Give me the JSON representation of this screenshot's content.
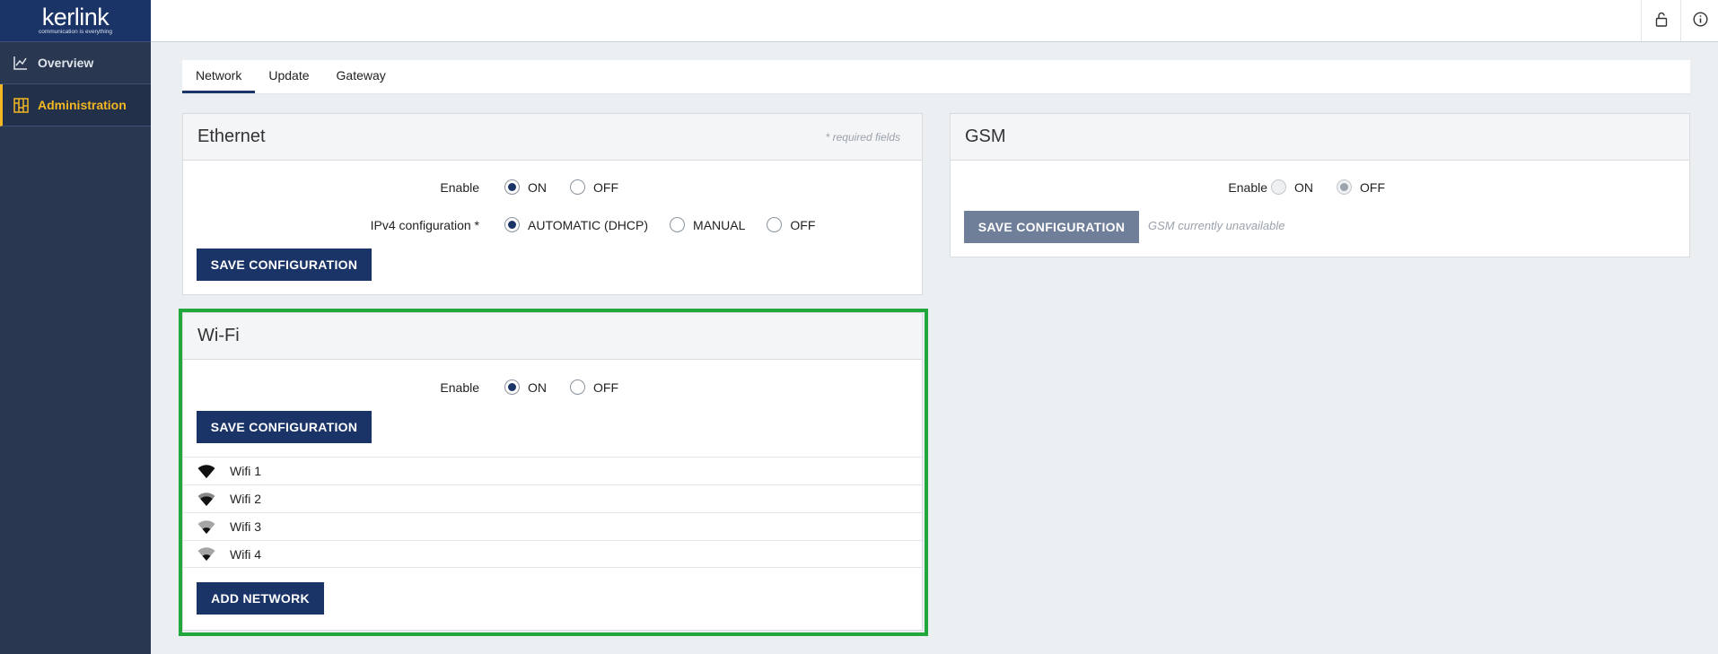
{
  "logo": {
    "word": "kerlink",
    "tagline": "communication is everything"
  },
  "sidebar": {
    "items": [
      {
        "label": "Overview",
        "icon": "chart-line-icon"
      },
      {
        "label": "Administration",
        "icon": "building-icon"
      }
    ]
  },
  "topbar": {
    "icons": [
      "unlock-icon",
      "info-icon"
    ]
  },
  "tabs": [
    {
      "label": "Network"
    },
    {
      "label": "Update"
    },
    {
      "label": "Gateway"
    }
  ],
  "ethernet": {
    "title": "Ethernet",
    "required_note": "* required fields",
    "enable_label": "Enable",
    "enable_on": "ON",
    "enable_off": "OFF",
    "ipv4_label": "IPv4 configuration *",
    "ipv4_automatic": "AUTOMATIC (DHCP)",
    "ipv4_manual": "MANUAL",
    "ipv4_off": "OFF",
    "save_label": "SAVE CONFIGURATION"
  },
  "gsm": {
    "title": "GSM",
    "enable_label": "Enable",
    "enable_on": "ON",
    "enable_off": "OFF",
    "save_label": "SAVE CONFIGURATION",
    "unavailable_note": "GSM currently unavailable"
  },
  "wifi": {
    "title": "Wi-Fi",
    "enable_label": "Enable",
    "enable_on": "ON",
    "enable_off": "OFF",
    "save_label": "SAVE CONFIGURATION",
    "networks": [
      {
        "name": "Wifi 1"
      },
      {
        "name": "Wifi 2"
      },
      {
        "name": "Wifi 3"
      },
      {
        "name": "Wifi 4"
      }
    ],
    "add_label": "ADD NETWORK"
  },
  "colors": {
    "sidebar": "#2a3750",
    "brand": "#1b3468",
    "active": "#f2b722",
    "highlight": "#22a73c"
  }
}
